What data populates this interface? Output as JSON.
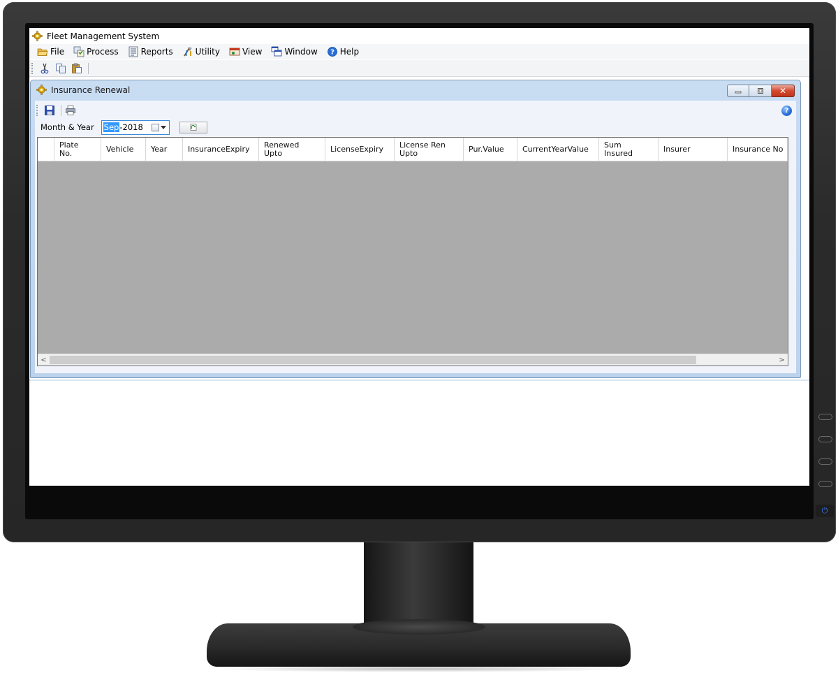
{
  "app": {
    "title": "Fleet Management System"
  },
  "menu": {
    "items": [
      {
        "label": "File",
        "icon": "folder-open-icon"
      },
      {
        "label": "Process",
        "icon": "process-icon"
      },
      {
        "label": "Reports",
        "icon": "reports-icon"
      },
      {
        "label": "Utility",
        "icon": "utility-icon"
      },
      {
        "label": "View",
        "icon": "view-icon"
      },
      {
        "label": "Window",
        "icon": "window-icon"
      },
      {
        "label": "Help",
        "icon": "help-icon"
      }
    ]
  },
  "toolbar": {
    "buttons": [
      "cut-icon",
      "copy-icon",
      "paste-icon"
    ]
  },
  "child_window": {
    "title": "Insurance Renewal",
    "tools": [
      "save-icon",
      "print-icon"
    ],
    "help_glyph": "?",
    "close_glyph": "✕",
    "filter": {
      "label": "Month & Year",
      "month": "Sep",
      "year_suffix": "-2018"
    }
  },
  "grid": {
    "columns": [
      {
        "label": ""
      },
      {
        "label": "Plate\nNo."
      },
      {
        "label": "Vehicle"
      },
      {
        "label": "Year"
      },
      {
        "label": "InsuranceExpiry"
      },
      {
        "label": "Renewed\nUpto"
      },
      {
        "label": "LicenseExpiry"
      },
      {
        "label": "License Ren\nUpto"
      },
      {
        "label": "Pur.Value"
      },
      {
        "label": "CurrentYearValue"
      },
      {
        "label": "Sum\nInsured"
      },
      {
        "label": "Insurer"
      },
      {
        "label": "Insurance No"
      }
    ],
    "rows": [],
    "scroll_left": "<",
    "scroll_right": ">"
  },
  "monitor": {
    "power_glyph": "⏻"
  },
  "colors": {
    "child_window_frame": "#bcd3ee",
    "grid_background": "#ababab",
    "selection": "#3399ff",
    "close_button": "#c1341c"
  }
}
